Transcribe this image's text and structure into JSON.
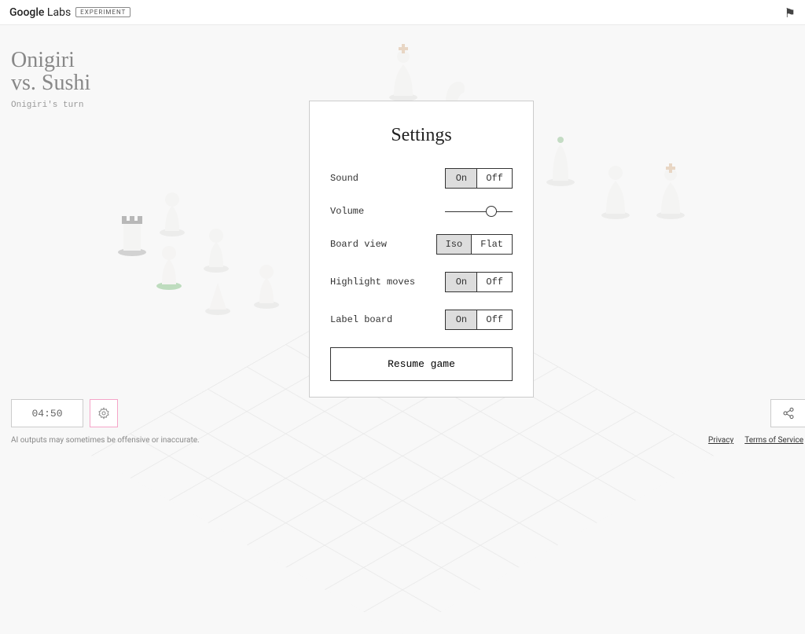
{
  "header": {
    "brand_prefix": "Google",
    "brand_suffix": "Labs",
    "badge": "EXPERIMENT"
  },
  "game": {
    "player1": "Onigiri",
    "vs_label": "vs.",
    "player2": "Sushi",
    "turn_label": "Onigiri's turn",
    "timer": "04:50"
  },
  "settings": {
    "title": "Settings",
    "sound": {
      "label": "Sound",
      "on": "On",
      "off": "Off",
      "value": "On"
    },
    "volume": {
      "label": "Volume",
      "value": 0.65
    },
    "board_view": {
      "label": "Board view",
      "iso": "Iso",
      "flat": "Flat",
      "value": "Iso"
    },
    "highlight": {
      "label": "Highlight moves",
      "on": "On",
      "off": "Off",
      "value": "On"
    },
    "label_board": {
      "label": "Label board",
      "on": "On",
      "off": "Off",
      "value": "On"
    },
    "resume_label": "Resume game"
  },
  "footer": {
    "disclaimer": "AI outputs may sometimes be offensive or inaccurate.",
    "privacy": "Privacy",
    "terms": "Terms of Service"
  }
}
